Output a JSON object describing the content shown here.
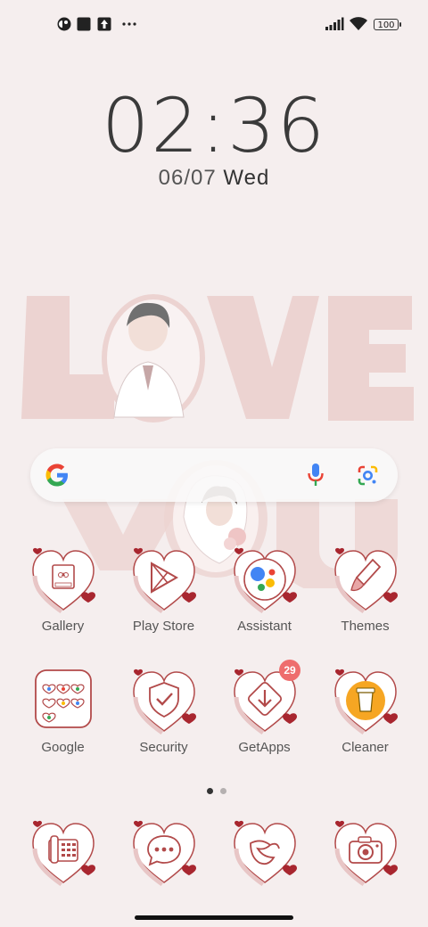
{
  "status_bar": {
    "icons_left": [
      "app-notification-icon",
      "square-notification-icon",
      "upload-icon",
      "more-icon"
    ],
    "icons_right": [
      "signal-icon",
      "wifi-icon",
      "battery-icon"
    ],
    "battery": "100"
  },
  "lockclock": {
    "time": "02:36",
    "date": "06/07",
    "weekday": "Wed"
  },
  "search_widget": {
    "icons": [
      "google-g-icon",
      "microphone-icon",
      "google-lens-icon"
    ]
  },
  "apps_row1": [
    {
      "label": "Gallery",
      "icon": "gallery-icon"
    },
    {
      "label": "Play Store",
      "icon": "play-store-icon"
    },
    {
      "label": "Assistant",
      "icon": "assistant-icon"
    },
    {
      "label": "Themes",
      "icon": "themes-icon"
    }
  ],
  "apps_row2": [
    {
      "label": "Google",
      "icon": "google-folder-icon"
    },
    {
      "label": "Security",
      "icon": "security-icon"
    },
    {
      "label": "GetApps",
      "icon": "getapps-icon",
      "badge": "29"
    },
    {
      "label": "Cleaner",
      "icon": "cleaner-icon"
    }
  ],
  "dock": [
    {
      "icon": "phone-icon"
    },
    {
      "icon": "messages-icon"
    },
    {
      "icon": "browser-icon"
    },
    {
      "icon": "camera-icon"
    }
  ],
  "page_indicator": {
    "pages": 2,
    "current": 1
  },
  "colors": {
    "background": "#f5eeee",
    "heart_outline": "#b24a4a",
    "heart_accent": "#a8262f",
    "badge": "#ee6d6d"
  }
}
